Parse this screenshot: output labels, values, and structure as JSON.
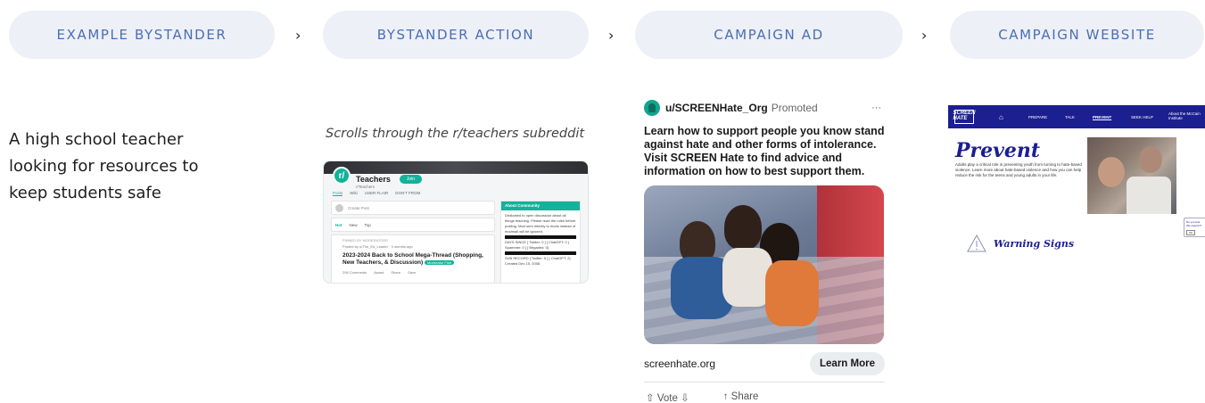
{
  "steps": [
    {
      "label": "EXAMPLE BYSTANDER"
    },
    {
      "label": "BYSTANDER ACTION"
    },
    {
      "label": "CAMPAIGN AD"
    },
    {
      "label": "CAMPAIGN WEBSITE"
    }
  ],
  "arrow_glyph": "›",
  "bystander": {
    "description": "A high school teacher looking for resources to keep students safe"
  },
  "action": {
    "caption": "Scrolls through the r/teachers subreddit",
    "reddit": {
      "logo": "r/",
      "community_name": "Teachers",
      "join_label": "Join",
      "subreddit_handle": "r/Teachers",
      "tabs": [
        "Posts",
        "Wiki",
        "USER FLAIR",
        "DON'T FROM"
      ],
      "create_post_placeholder": "Create Post",
      "sort": {
        "hot": "Hot",
        "new": "New",
        "top": "Top"
      },
      "post": {
        "pinned_label": "PINNED BY MODERATORS",
        "meta": "Posted by u/The_Ed_Leader · 3 months ago",
        "title": "2023-2024 Back to School Mega-Thread (Shopping, New Teachers, & Discussion)",
        "flair": "Moderator Flair",
        "comments": "296 Comments",
        "award": "Award",
        "share": "Share",
        "save": "Save"
      },
      "sidebar": {
        "header": "About Community",
        "body": "Dedicated to open discussion about all things teaching. Please read the rules before posting. Mod sent directly to mods instead of modmail will be ignored.",
        "days_since": "DAYS SINCE [ Twitter: 0 ] [ ChatGPT: 0 ]",
        "spammer": "Spammer: 0 ] [ Brigaded: 0]",
        "sub_record": "SUB RECORD [ Twitter: 5 ] [ ChatGPT: 2]",
        "created": "Created Dec 15, 2008"
      }
    }
  },
  "ad": {
    "username": "u/SCREENHate_Org",
    "promoted": "Promoted",
    "more": "···",
    "text": "Learn how to support people you know stand against hate and other forms of intolerance. Visit SCREEN Hate to find advice and information on how to best support them.",
    "domain": "screenhate.org",
    "cta": "Learn More",
    "vote": "Vote",
    "share": "Share",
    "accent": "#11a48f"
  },
  "website": {
    "logo": "SCREEN HATE",
    "nav": [
      "PREPARE",
      "TALK",
      "PREVENT",
      "SEEK HELP",
      "About the McCain Institute"
    ],
    "active_nav": "PREVENT",
    "title": "Prevent",
    "body": "Adults play a critical role in preventing youth from turning to hate-based violence. Learn more about hate-based violence and how you can help reduce the risk for the teens and young adults in your life.",
    "chat_prompt": "Do you feel this support?",
    "chat_ok": "OK",
    "warning": "Warning Signs",
    "brand_color": "#1c1f8f"
  }
}
